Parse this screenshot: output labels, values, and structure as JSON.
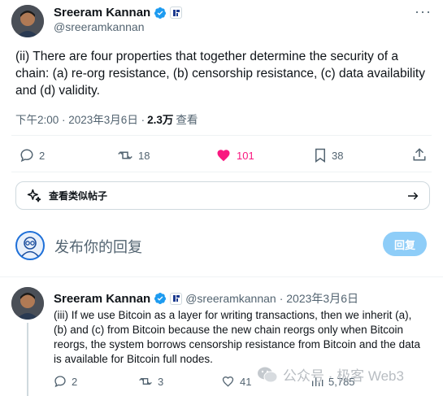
{
  "main_tweet": {
    "author_name": "Sreeram Kannan",
    "author_handle": "@sreeramkannan",
    "text": "(ii) There are four properties that together determine the security of a chain: (a) re-org resistance, (b) censorship resistance, (c) data availability and (d) validity.",
    "timestamp": "下午2:00 · 2023年3月6日 · ",
    "views_count": "2.3万",
    "views_label": " 查看",
    "replies": "2",
    "retweets": "18",
    "likes": "101",
    "bookmarks": "38"
  },
  "similar_posts": {
    "label": "查看类似帖子"
  },
  "compose": {
    "placeholder": "发布你的回复",
    "button_label": "回复"
  },
  "reply_tweet": {
    "author_name": "Sreeram Kannan",
    "author_handle": "@sreeramkannan",
    "date": " · 2023年3月6日",
    "text": "(iii) If we use Bitcoin as a layer for writing transactions, then we inherit (a), (b) and (c) from Bitcoin because the new chain reorgs only when Bitcoin reorgs, the system borrows censorship resistance from Bitcoin and the data is available for Bitcoin full nodes.",
    "replies": "2",
    "retweets": "3",
    "likes": "41",
    "views": "5,785"
  },
  "watermark": {
    "text": "公众号 · 极客 Web3"
  },
  "colors": {
    "accent": "#1d9bf0",
    "like": "#f91880",
    "muted": "#536471",
    "reply_button": "#8ecdf8"
  },
  "icons": [
    "avatar",
    "verified-badge-icon",
    "affiliate-badge-icon",
    "more-icon",
    "reply-icon",
    "retweet-icon",
    "heart-icon",
    "bookmark-icon",
    "share-icon",
    "sparkle-icon",
    "arrow-right-icon",
    "views-icon",
    "wechat-icon"
  ]
}
